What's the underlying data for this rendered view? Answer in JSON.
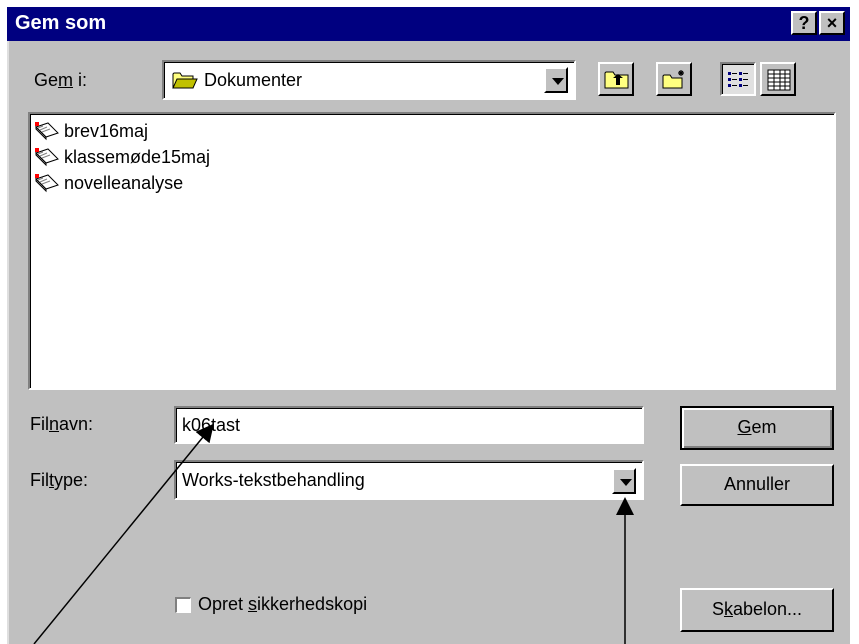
{
  "dialog": {
    "title": "Gem som",
    "help_button": "?",
    "close_button": "×"
  },
  "location": {
    "label_pre": "Ge",
    "label_key": "m",
    "label_post": " i:",
    "current_folder": "Dokumenter",
    "folder_icon": "open-folder-icon",
    "toolbar_icons": [
      "up-one-level-icon",
      "new-folder-icon",
      "list-view-icon",
      "details-view-icon"
    ]
  },
  "files": [
    {
      "name": "brev16maj",
      "icon": "works-document-icon"
    },
    {
      "name": "klassemøde15maj",
      "icon": "works-document-icon"
    },
    {
      "name": "novelleanalyse",
      "icon": "works-document-icon"
    }
  ],
  "filename": {
    "label_pre": "Fil",
    "label_key": "n",
    "label_post": "avn:",
    "value": "k06tast"
  },
  "filetype": {
    "label_pre": "Fil",
    "label_key": "t",
    "label_post": "ype:",
    "selected": "Works-tekstbehandling"
  },
  "buttons": {
    "save_key": "G",
    "save_rest": "em",
    "cancel": "Annuller",
    "template_pre": "S",
    "template_key": "k",
    "template_post": "abelon..."
  },
  "backup": {
    "label_pre": "Opret ",
    "label_key": "s",
    "label_post": "ikkerhedskopi",
    "checked": false
  },
  "colors": {
    "titlebar": "#000080",
    "dialog_bg": "#c0c0c0"
  }
}
